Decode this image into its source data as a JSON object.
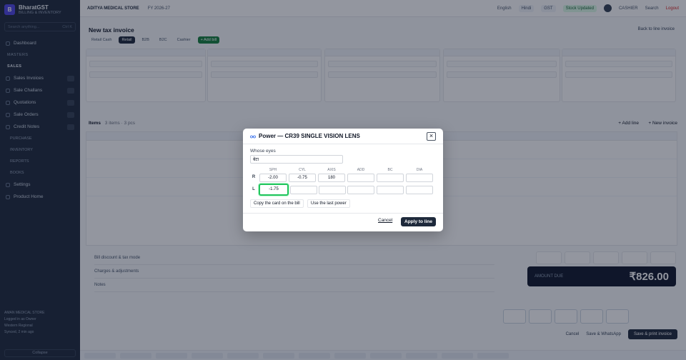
{
  "sidebar": {
    "brand_name": "BharatGST",
    "brand_sub": "BILLING & INVENTORY",
    "search_placeholder": "Search anything...",
    "search_shortcut": "Ctrl K",
    "items": [
      {
        "label": "Dashboard"
      },
      {
        "section": "MASTERS"
      },
      {
        "section": "SALES"
      },
      {
        "label": "Sales Invoices"
      },
      {
        "label": "Sale Challans"
      },
      {
        "label": "Quotations"
      },
      {
        "label": "Sale Orders"
      },
      {
        "label": "Credit Notes"
      }
    ],
    "sub_items": [
      "PURCHASE",
      "INVENTORY",
      "REPORTS",
      "BOOKS"
    ],
    "bottom_items": [
      "Settings",
      "Product Home"
    ],
    "footer_store": "AMAN MEDICAL STORE",
    "footer_user": "Logged in as Owner",
    "footer_location": "Western Regional",
    "footer_status": "Synced, 2 min ago",
    "collapse_label": "Collapse"
  },
  "topbar": {
    "store_name": "ADITYA MEDICAL STORE",
    "fy_label": "FY 2026-27",
    "lang_en": "English",
    "lang_hi": "Hindi",
    "gst_label": "GST",
    "status_label": "Stock Updated",
    "user": "CASHIER",
    "search": "Search",
    "logout": "Logout"
  },
  "page": {
    "title": "New tax invoice",
    "back_label": "Back to line invoice",
    "tabs": [
      "Retail Cash",
      "Retail",
      "B2B",
      "B2C",
      "Cashier"
    ],
    "action_tab": "+ Add bill",
    "items_label": "Items",
    "items_count": "3 items · 3 pcs",
    "add_line_label": "+ Add line",
    "new_invoice_label": "+ New invoice"
  },
  "summary": {
    "discount_row": "Bill discount & tax mode",
    "charges_row": "Charges & adjustments",
    "notes_row": "Notes",
    "total_label": "AMOUNT DUE",
    "total_amount": "₹826.00",
    "cancel_label": "Cancel",
    "save_whatsapp_label": "Save & WhatsApp",
    "save_print_label": "Save & print invoice"
  },
  "modal": {
    "title": "Power — CR39 SINGLE VISION LENS",
    "whose_eyes_label": "Whose eyes",
    "whose_eyes_value": "बेटा",
    "columns": [
      "SPH",
      "CYL",
      "AXIS",
      "ADD",
      "BC",
      "DIA"
    ],
    "rows": [
      {
        "label": "R",
        "values": [
          "-2.00",
          "-0.75",
          "180",
          "",
          "",
          ""
        ]
      },
      {
        "label": "L",
        "values": [
          "-1.75",
          "",
          "",
          "",
          "",
          ""
        ]
      }
    ],
    "copy_card_label": "Copy the card on the bill",
    "use_last_label": "Use the last power",
    "cancel_label": "Cancel",
    "apply_label": "Apply to line"
  },
  "colors": {
    "sidebar_bg": "#1e293b",
    "accent": "#4f46e5",
    "focus_ring": "#22c55e",
    "primary_button": "#1e293b"
  }
}
